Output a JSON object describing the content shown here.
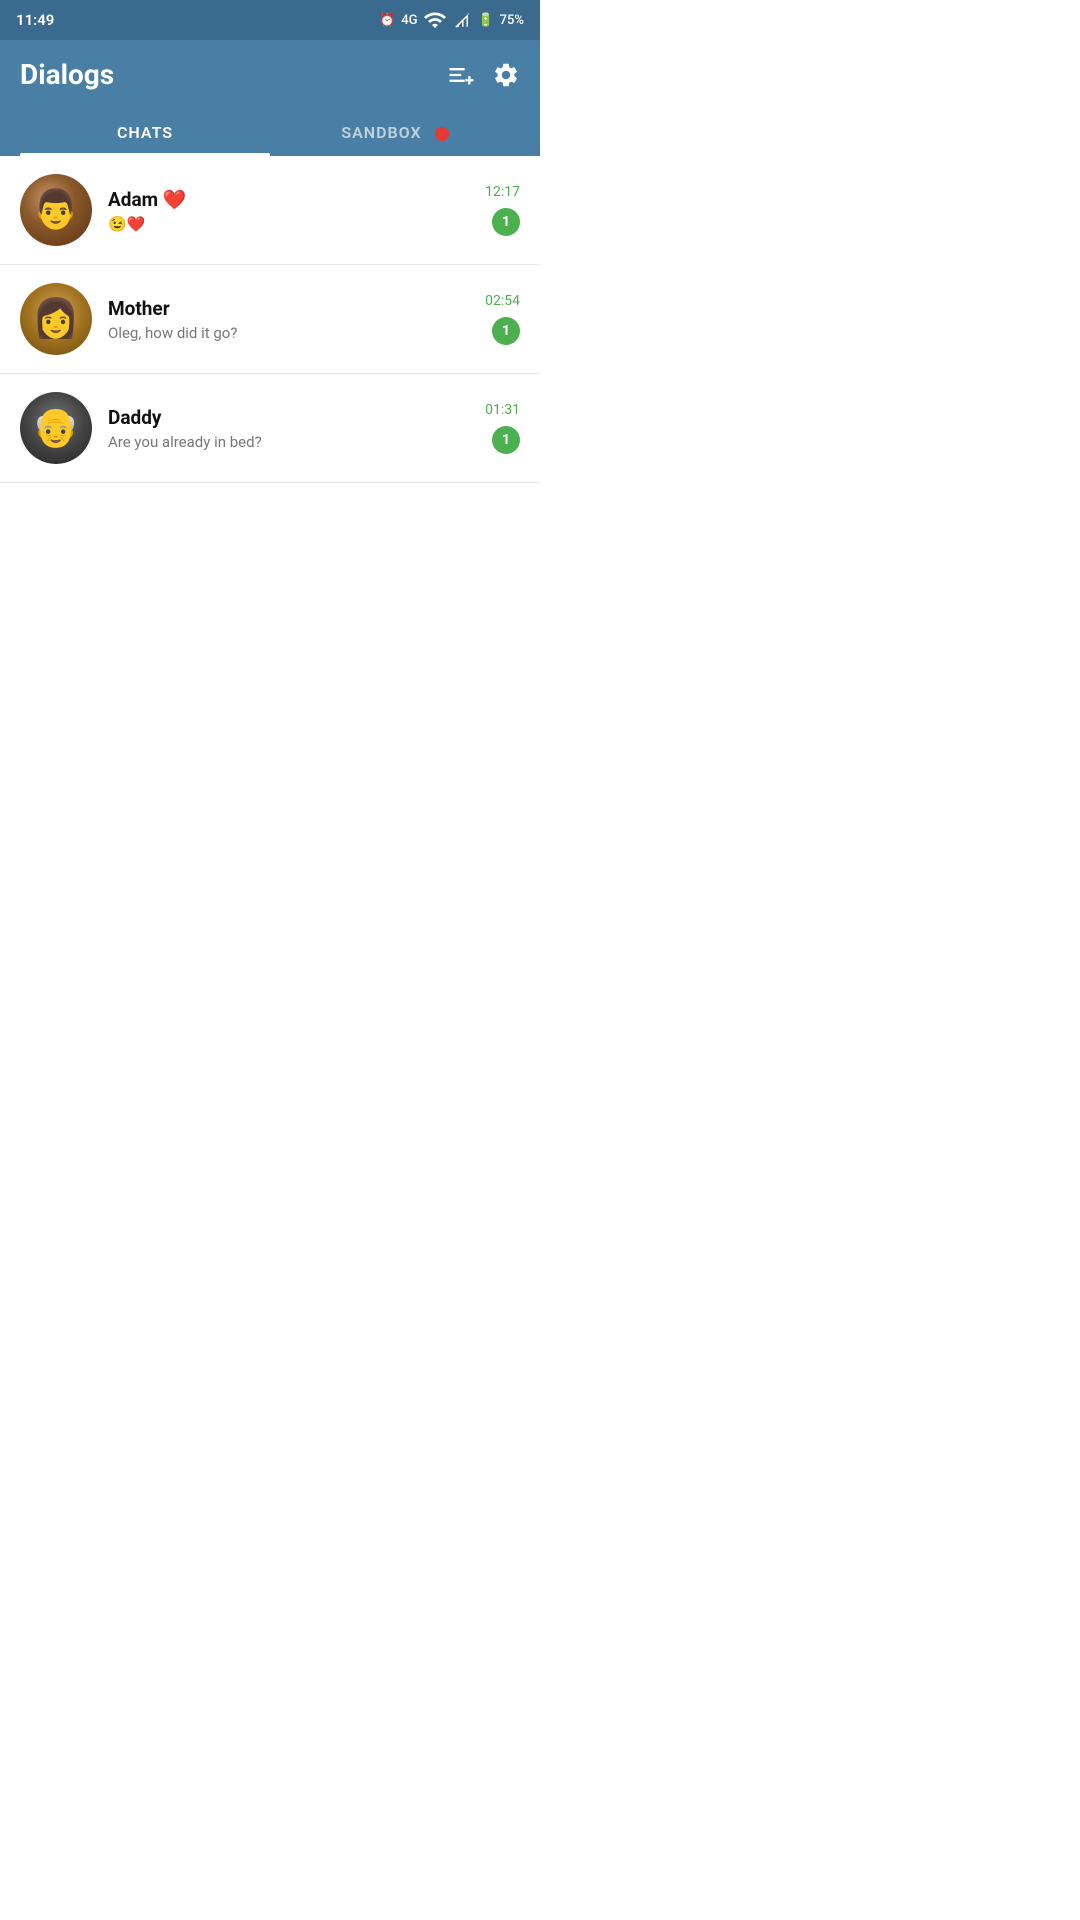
{
  "statusBar": {
    "time": "11:49",
    "battery": "75%",
    "network": "4G"
  },
  "header": {
    "title": "Dialogs",
    "addIcon": "≡+",
    "settingsIcon": "⚙"
  },
  "tabs": [
    {
      "id": "chats",
      "label": "CHATS",
      "active": true,
      "badge": false
    },
    {
      "id": "sandbox",
      "label": "SANDBOX",
      "active": false,
      "badge": true
    }
  ],
  "chats": [
    {
      "id": "adam",
      "name": "Adam ❤️",
      "nameEmoji": "❤️",
      "message": "😉❤️",
      "time": "12:17",
      "unread": 1,
      "avatarClass": "avatar-adam"
    },
    {
      "id": "mother",
      "name": "Mother",
      "message": "Oleg, how did it go?",
      "time": "02:54",
      "unread": 1,
      "avatarClass": "avatar-mother"
    },
    {
      "id": "daddy",
      "name": "Daddy",
      "message": "Are you already in bed?",
      "time": "01:31",
      "unread": 1,
      "avatarClass": "avatar-daddy"
    }
  ],
  "colors": {
    "headerBg": "#4a7fa5",
    "activeTab": "#ffffff",
    "inactiveTab": "rgba(255,255,255,0.65)",
    "unreadBadge": "#4caf50",
    "sandboxDot": "#e53935",
    "timeColor": "#4caf50"
  }
}
